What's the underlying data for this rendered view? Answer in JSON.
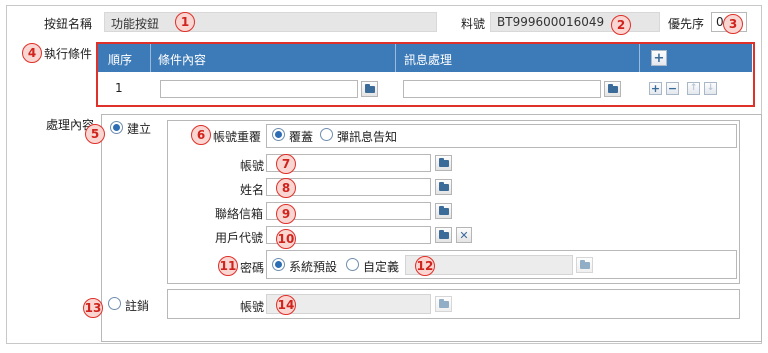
{
  "header": {
    "button_name_label": "按鈕名稱",
    "button_name_value": "功能按鈕",
    "part_no_label": "料號",
    "part_no_value": "BT999600016049",
    "priority_label": "優先序",
    "priority_value": "0"
  },
  "conditions": {
    "label": "執行條件",
    "columns": [
      "順序",
      "條件內容",
      "訊息處理"
    ],
    "rows": [
      {
        "seq": "1",
        "content": "",
        "message": ""
      }
    ]
  },
  "processing": {
    "label": "處理內容",
    "create": {
      "label": "建立",
      "selected": true,
      "duplicate_label": "帳號重覆",
      "duplicate_options": [
        {
          "label": "覆蓋",
          "selected": true
        },
        {
          "label": "彈訊息告知",
          "selected": false
        }
      ],
      "fields": [
        {
          "label": "帳號",
          "value": ""
        },
        {
          "label": "姓名",
          "value": ""
        },
        {
          "label": "聯絡信箱",
          "value": ""
        },
        {
          "label": "用戶代號",
          "value": ""
        }
      ],
      "password_label": "密碼",
      "password_options": [
        {
          "label": "系統預設",
          "selected": true
        },
        {
          "label": "自定義",
          "selected": false
        }
      ]
    },
    "cancel": {
      "label": "註銷",
      "selected": false,
      "account_label": "帳號"
    }
  },
  "callouts": [
    "1",
    "2",
    "3",
    "4",
    "5",
    "6",
    "7",
    "8",
    "9",
    "10",
    "11",
    "12",
    "13",
    "14"
  ],
  "colors": {
    "grid_header": "#3d7ab8",
    "highlight": "#e0302a",
    "callout_fill": "#f9d6d1"
  }
}
